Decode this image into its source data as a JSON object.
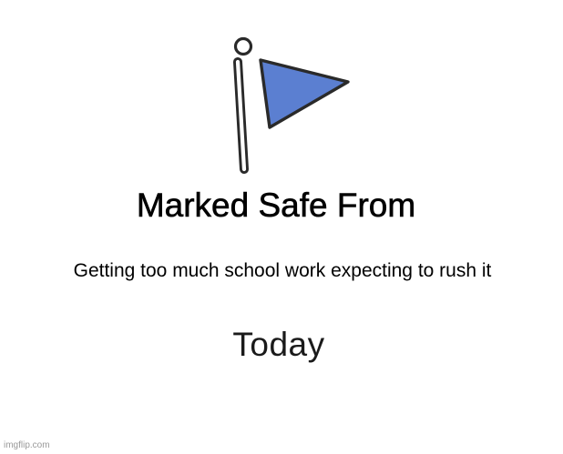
{
  "meme": {
    "title": "Marked Safe From",
    "caption": "Getting too much school work expecting to rush it",
    "footer": "Today",
    "watermark": "imgflip.com"
  },
  "icons": {
    "flag": "flag-icon"
  },
  "colors": {
    "flag_fill": "#5b7fd1",
    "outline": "#2a2a2a",
    "background": "#ffffff"
  }
}
